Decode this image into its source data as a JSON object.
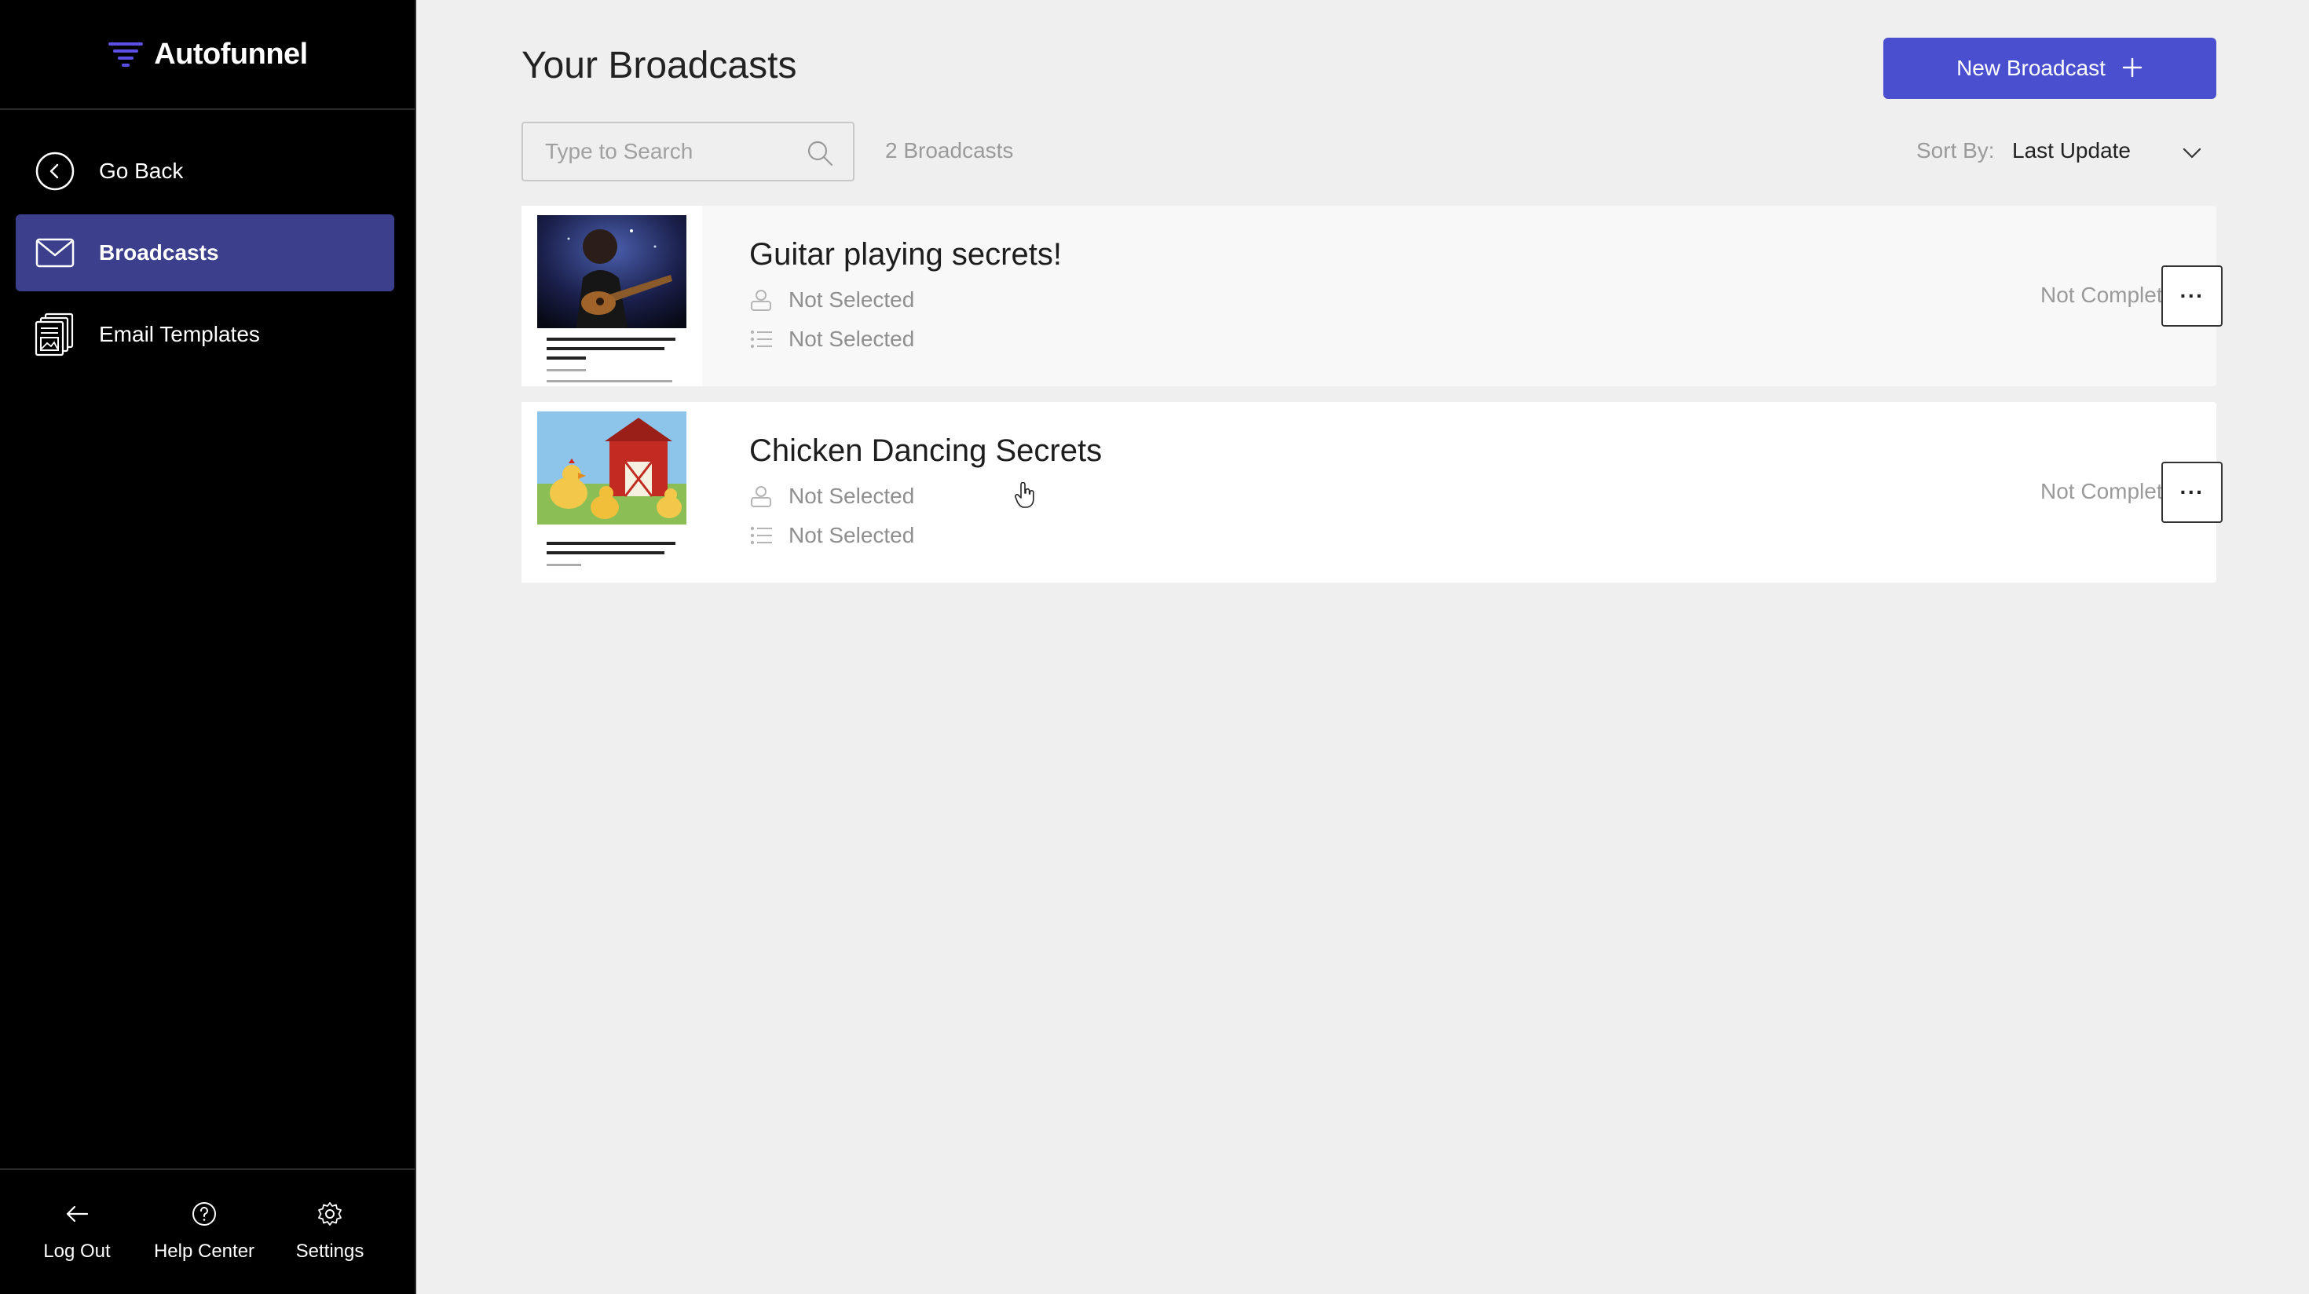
{
  "app": {
    "name": "Autofunnel",
    "accent_color": "#4a4fd0",
    "active_nav_color": "#3b3f8c"
  },
  "sidebar": {
    "items": [
      {
        "label": "Go Back",
        "icon": "chevron-left-circle-icon",
        "active": false
      },
      {
        "label": "Broadcasts",
        "icon": "mail-icon",
        "active": true
      },
      {
        "label": "Email Templates",
        "icon": "templates-icon",
        "active": false
      }
    ],
    "footer": [
      {
        "label": "Log Out",
        "icon": "arrow-left-icon"
      },
      {
        "label": "Help Center",
        "icon": "help-circle-icon"
      },
      {
        "label": "Settings",
        "icon": "gear-icon"
      }
    ]
  },
  "header": {
    "title": "Your Broadcasts",
    "new_button_label": "New Broadcast",
    "new_button_icon": "plus-icon"
  },
  "toolbar": {
    "search_placeholder": "Type to Search",
    "search_value": "",
    "count_text": "2 Broadcasts",
    "sort_label": "Sort By:",
    "sort_value": "Last Update"
  },
  "broadcasts": [
    {
      "title": "Guitar playing secrets!",
      "sender": "Not Selected",
      "list": "Not Selected",
      "status": "Not Completed",
      "more_label": "···"
    },
    {
      "title": "Chicken Dancing Secrets",
      "sender": "Not Selected",
      "list": "Not Selected",
      "status": "Not Completed",
      "more_label": "···"
    }
  ]
}
